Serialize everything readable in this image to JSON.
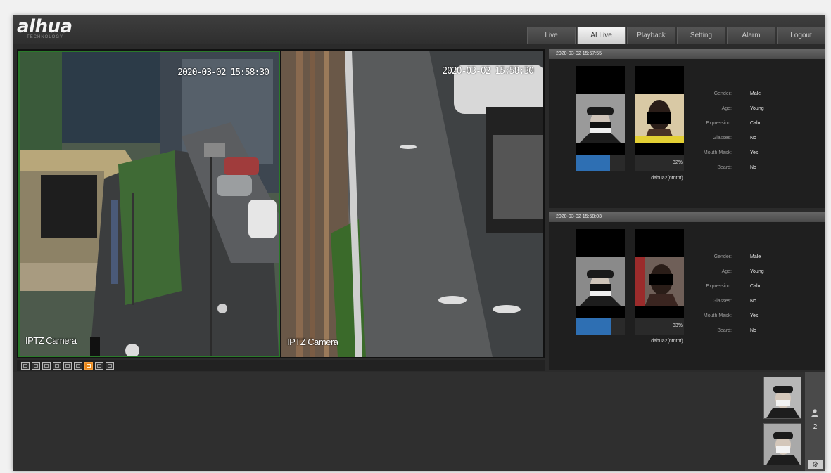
{
  "brand": {
    "logo": "alhua",
    "tagline": "TECHNOLOGY"
  },
  "nav": {
    "tabs": [
      "Live",
      "AI Live",
      "Playback",
      "Setting",
      "Alarm",
      "Logout"
    ],
    "active": "AI Live"
  },
  "videos": [
    {
      "timestamp": "2020-03-02 15:58:30",
      "name": "IPTZ Camera"
    },
    {
      "timestamp": "2020-03-02 15:58:30",
      "name": "IPTZ Camera"
    }
  ],
  "toolbar": {
    "icons": [
      "fullscreen-icon",
      "ratio-icon",
      "snapshot-icon",
      "record-icon",
      "layout-1-icon",
      "layout-2-icon",
      "layout-4-icon",
      "layout-9-icon",
      "layout-16-icon"
    ],
    "active_index": 6
  },
  "events": [
    {
      "time": "2020-03-02 15:57:55",
      "similarity": "32%",
      "library": "dahua2(ntntnt)",
      "labels": [
        "Gender:",
        "Age:",
        "Expression:",
        "Glasses:",
        "Mouth Mask:",
        "Beard:"
      ],
      "values": [
        "Male",
        "Young",
        "Calm",
        "No",
        "Yes",
        "No"
      ]
    },
    {
      "time": "2020-03-02 15:58:03",
      "similarity": "33%",
      "library": "dahua2(ntntnt)",
      "labels": [
        "Gender:",
        "Age:",
        "Expression:",
        "Glasses:",
        "Mouth Mask:",
        "Beard:"
      ],
      "values": [
        "Male",
        "Young",
        "Calm",
        "No",
        "Yes",
        "No"
      ]
    }
  ],
  "bottom": {
    "face_count": "2"
  },
  "colors": {
    "accent": "#e8861a",
    "active_border": "#2a7a2a",
    "match_blue": "#2e6fb3"
  }
}
